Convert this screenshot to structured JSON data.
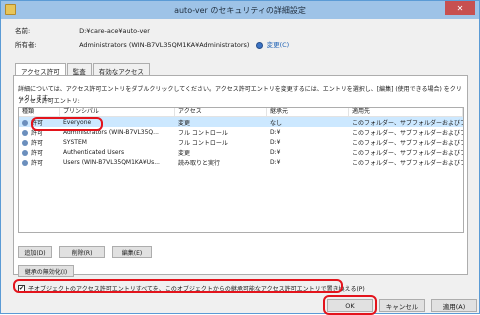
{
  "window": {
    "title": "auto-ver のセキュリティの詳細設定",
    "close_glyph": "✕"
  },
  "info": {
    "name_label": "名前:",
    "name_value": "D:¥care-ace¥auto-ver",
    "owner_label": "所有者:",
    "owner_value": "Administrators (WIN-B7VL35QM1KA¥Administrators)",
    "change_link": "変更(C)"
  },
  "tabs": [
    "アクセス許可",
    "監査",
    "有効なアクセス"
  ],
  "panel": {
    "description": "詳細については、アクセス許可エントリをダブルクリックしてください。アクセス許可エントリを変更するには、エントリを選択し、[編集] (使用できる場合) をクリックします。",
    "list_label": "アクセス許可エントリ:",
    "columns": [
      "種類",
      "プリンシパル",
      "アクセス",
      "継承元",
      "適用先"
    ],
    "rows": [
      {
        "type": "許可",
        "principal": "Everyone",
        "access": "変更",
        "inherit": "なし",
        "applies": "このフォルダー、サブフォルダーおよびファイル"
      },
      {
        "type": "許可",
        "principal": "Administrators (WIN-B7VL35Q...",
        "access": "フル コントロール",
        "inherit": "D:¥",
        "applies": "このフォルダー、サブフォルダーおよびファイル"
      },
      {
        "type": "許可",
        "principal": "SYSTEM",
        "access": "フル コントロール",
        "inherit": "D:¥",
        "applies": "このフォルダー、サブフォルダーおよびファイル"
      },
      {
        "type": "許可",
        "principal": "Authenticated Users",
        "access": "変更",
        "inherit": "D:¥",
        "applies": "このフォルダー、サブフォルダーおよびファイル"
      },
      {
        "type": "許可",
        "principal": "Users (WIN-B7VL35QM1KA¥Us...",
        "access": "読み取りと実行",
        "inherit": "D:¥",
        "applies": "このフォルダー、サブフォルダーおよびファイル"
      }
    ],
    "add_button": "追加(D)",
    "remove_button": "削除(R)",
    "edit_button": "編集(E)",
    "disable_inherit_button": "継承の無効化(I)",
    "replace_checkbox_label": "子オブジェクトのアクセス許可エントリすべてを、このオブジェクトからの継承可能なアクセス許可エントリで置き換える(P)",
    "replace_checked": true
  },
  "buttons": {
    "ok": "OK",
    "cancel": "キャンセル",
    "apply": "適用(A)"
  },
  "accent_color": "#e3141c"
}
